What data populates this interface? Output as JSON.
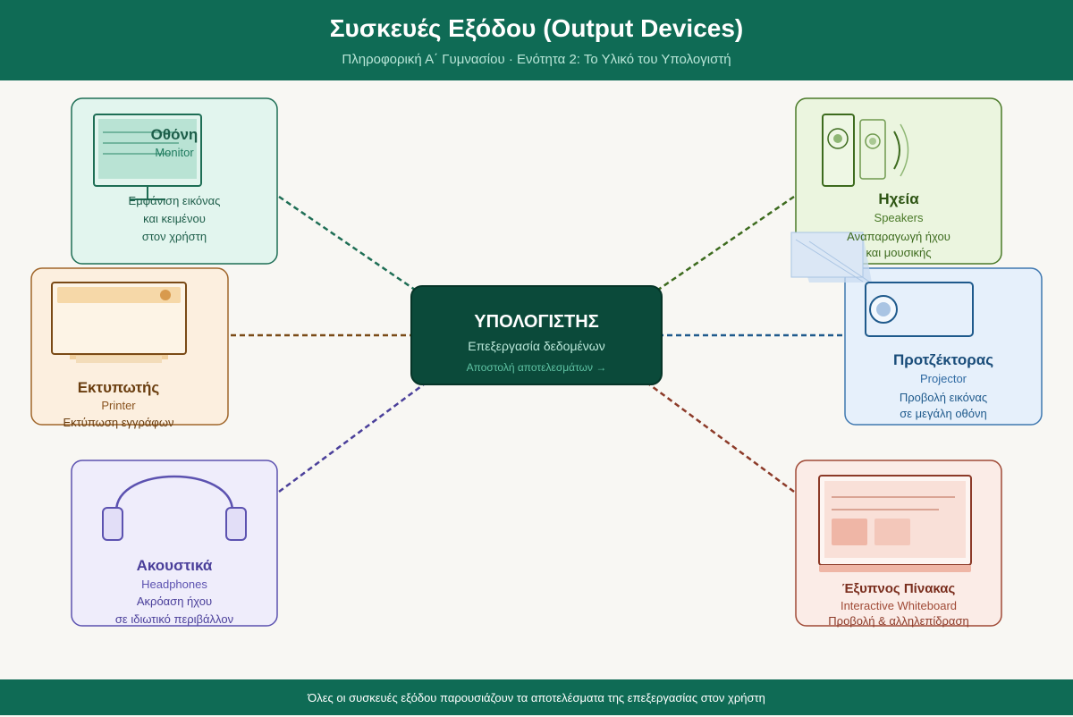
{
  "header": {
    "title": "Συσκευές Εξόδου (Output Devices)",
    "subtitle": "Πληροφορική Α΄ Γυμνασίου · Ενότητα 2: Το Υλικό του Υπολογιστή"
  },
  "center": {
    "title": "ΥΠΟΛΟΓΙΣΤΗΣ",
    "subtitle": "Επεξεργασία δεδομένων",
    "note": "Αποστολή αποτελεσμάτων →"
  },
  "devices": {
    "monitor": {
      "name": "Οθόνη",
      "en": "Monitor",
      "desc1": "Εμφάνιση εικόνας",
      "desc2": "και κειμένου",
      "desc3": "στον χρήστη"
    },
    "printer": {
      "name": "Εκτυπωτής",
      "en": "Printer",
      "desc1": "Εκτύπωση εγγράφων"
    },
    "headphones": {
      "name": "Ακουστικά",
      "en": "Headphones",
      "desc1": "Ακρόαση ήχου",
      "desc2": "σε ιδιωτικό περιβάλλον"
    },
    "speakers": {
      "name": "Ηχεία",
      "en": "Speakers",
      "desc1": "Αναπαραγωγή ήχου",
      "desc2": "και μουσικής"
    },
    "projector": {
      "name": "Προτζέκτορας",
      "en": "Projector",
      "desc1": "Προβολή εικόνας",
      "desc2": "σε μεγάλη οθόνη"
    },
    "whiteboard": {
      "name": "Έξυπνος Πίνακας",
      "en": "Interactive Whiteboard",
      "desc1": "Προβολή & αλληλεπίδραση"
    }
  },
  "footer": {
    "text": "Όλες οι συσκευές εξόδου παρουσιάζουν τα αποτελέσματα της επεξεργασίας στον χρήστη"
  },
  "colors": {
    "primary": "#0f6b55",
    "monitor": "#1e6e55",
    "printer": "#7a4a16",
    "headphones": "#4a3f9a",
    "speakers": "#3d6b1e",
    "projector": "#1f5a8c",
    "whiteboard": "#8c3a28"
  }
}
